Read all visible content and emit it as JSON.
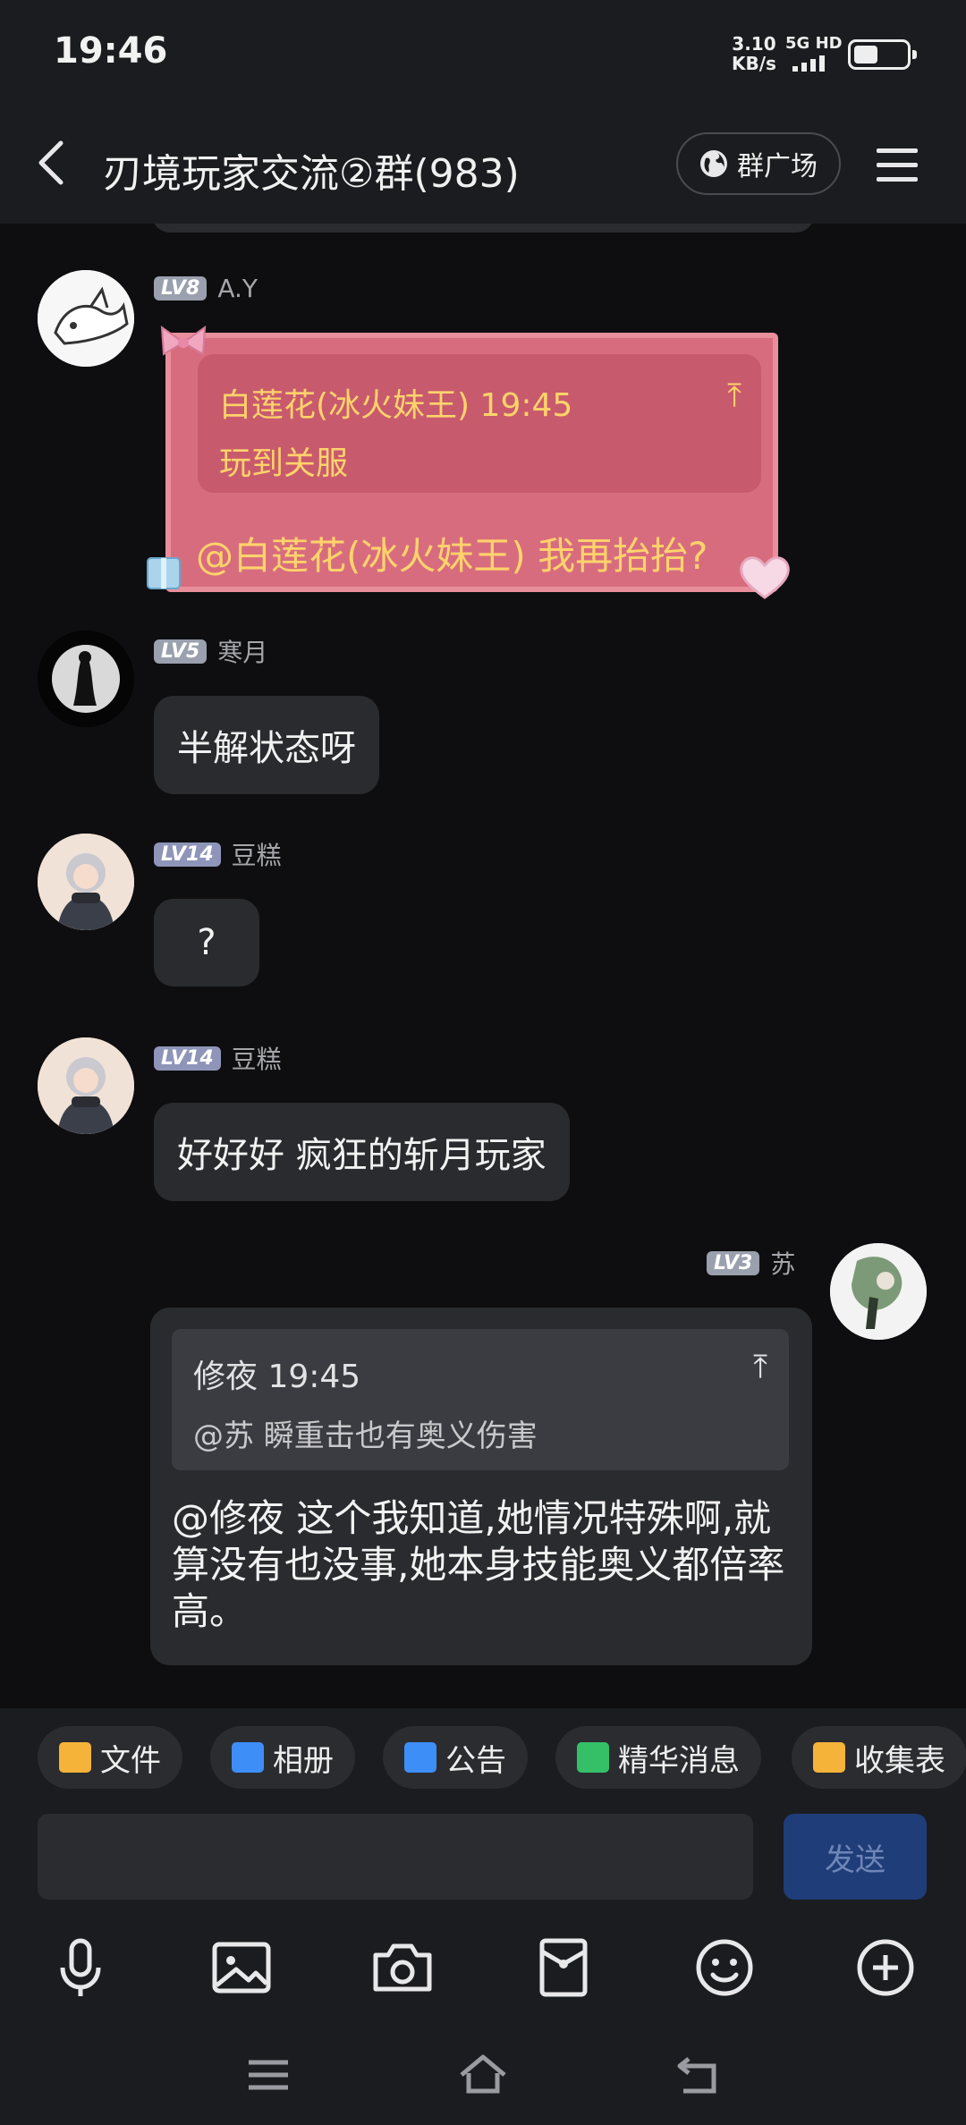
{
  "status_bar": {
    "time": "19:46",
    "speed_value": "3.10",
    "speed_unit": "KB/s",
    "network": "5G HD",
    "battery_level": 0.45
  },
  "header": {
    "title": "刃境玩家交流②群(983)",
    "plaza_label": "群广场"
  },
  "messages": [
    {
      "id": "m1",
      "level": "LV8",
      "sender": "A.Y",
      "quote_header": "白莲花(冰火妹王) 19:45",
      "quote_text": "玩到关服",
      "quote_up": "⤒",
      "text": "@白莲花(冰火妹王) 我再抬抬?"
    },
    {
      "id": "m2",
      "level": "LV5",
      "sender": "寒月",
      "text": "半解状态呀"
    },
    {
      "id": "m3",
      "level": "LV14",
      "sender": "豆糕",
      "text": "?"
    },
    {
      "id": "m4",
      "level": "LV14",
      "sender": "豆糕",
      "text": "好好好 疯狂的斩月玩家"
    },
    {
      "id": "m5",
      "level": "LV3",
      "sender": "苏",
      "quote_header": "修夜 19:45",
      "quote_text": "@苏 瞬重击也有奥义伤害",
      "quote_up": "⤒",
      "text": "@修夜 这个我知道,她情况特殊啊,就算没有也没事,她本身技能奥义都倍率高。"
    }
  ],
  "quick_actions": [
    {
      "label": "文件",
      "icon": "folder-icon",
      "color": "#f5b33a"
    },
    {
      "label": "相册",
      "icon": "album-icon",
      "color": "#3e8ef7"
    },
    {
      "label": "公告",
      "icon": "announcement-icon",
      "color": "#3e8ef7"
    },
    {
      "label": "精华消息",
      "icon": "highlight-icon",
      "color": "#35c068"
    },
    {
      "label": "收集表",
      "icon": "clipboard-icon",
      "color": "#f5b33a"
    }
  ],
  "composer": {
    "send_label": "发送"
  },
  "colors": {
    "background": "#0e0e10",
    "bar": "#1b1c1f",
    "bubble": "#2a2b2f",
    "special_card": "#d86c7f",
    "special_text": "#ffd36b",
    "send_button": "#1f3d78"
  }
}
